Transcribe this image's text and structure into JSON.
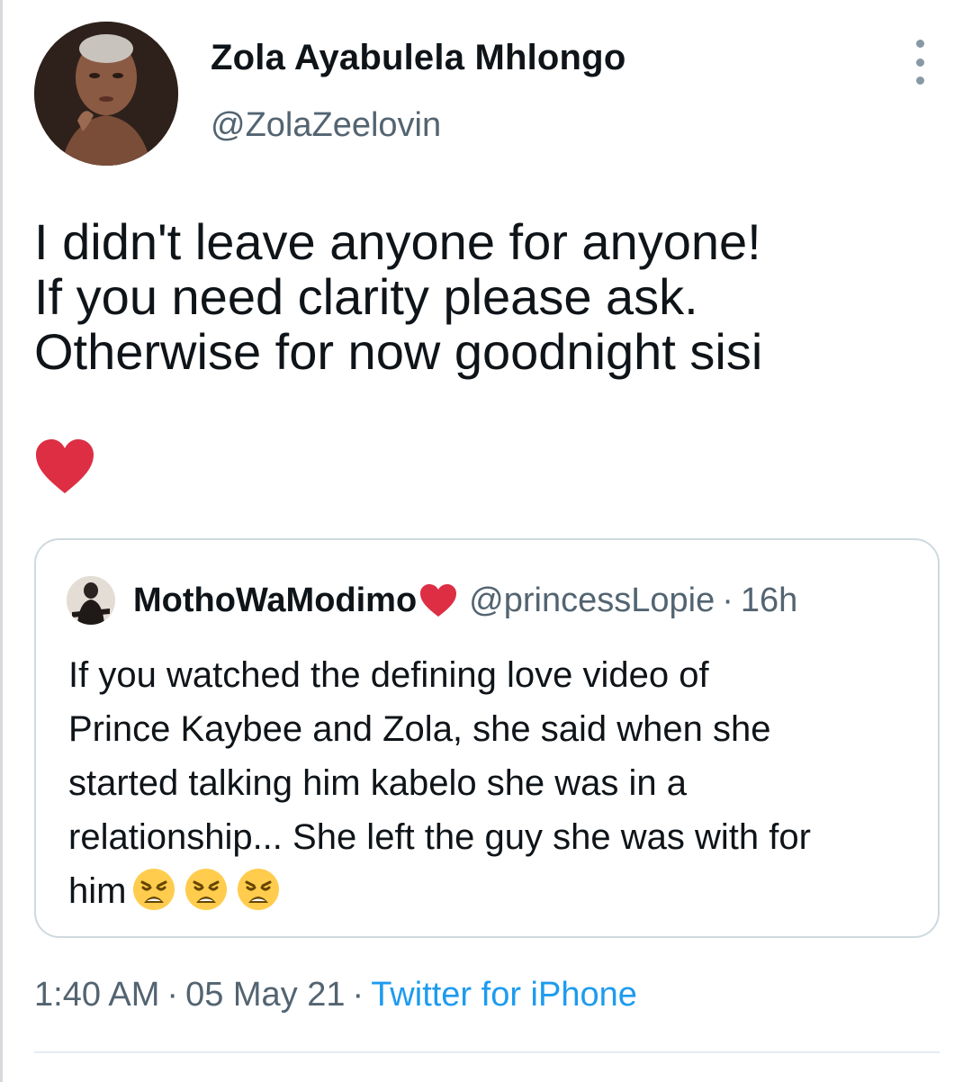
{
  "author": {
    "display_name": "Zola Ayabulela Mhlongo",
    "handle": "@ZolaZeelovin"
  },
  "tweet": {
    "lines": [
      "I didn't leave anyone for anyone!",
      "If you need clarity please ask.",
      "Otherwise for now goodnight sisi"
    ],
    "trailing_emoji": "red-heart"
  },
  "quoted_tweet": {
    "display_name": "MothoWaModimo",
    "name_emoji": "red-heart",
    "handle": "@princessLopie",
    "separator": "·",
    "time": "16h",
    "lines": [
      "If you watched the defining love video of",
      "Prince Kaybee and Zola, she said when she",
      "started talking him kabelo she was in a",
      "relationship... She left the guy she was with for",
      "him"
    ],
    "trailing_emojis": [
      "weary-face",
      "weary-face",
      "weary-face"
    ]
  },
  "meta": {
    "time": "1:40 AM",
    "separator": "·",
    "date": "05 May 21",
    "source": "Twitter for iPhone"
  },
  "colors": {
    "text": "#0f1419",
    "secondary": "#536471",
    "link": "#1d9bf0",
    "border": "#cfd9de",
    "heart": "#dd2e44"
  }
}
